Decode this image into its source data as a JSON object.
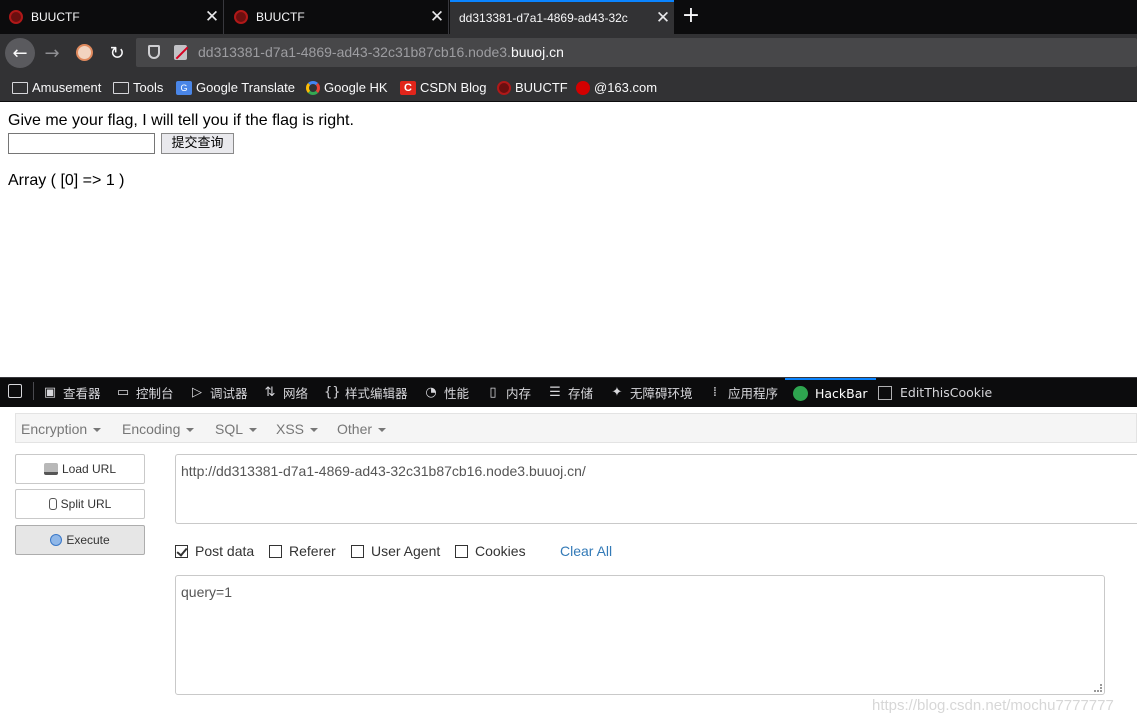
{
  "tabs": [
    {
      "title": "BUUCTF"
    },
    {
      "title": "BUUCTF"
    },
    {
      "title": "dd313381-d7a1-4869-ad43-32c"
    }
  ],
  "address_bar": {
    "url_prefix": "dd313381-d7a1-4869-ad43-32c31b87cb16.node3.",
    "url_host": "buuoj.cn"
  },
  "bookmarks": [
    {
      "label": "Amusement",
      "icon": "folder-icon"
    },
    {
      "label": "Tools",
      "icon": "folder-icon"
    },
    {
      "label": "Google Translate",
      "icon": "google-translate-icon"
    },
    {
      "label": "Google HK",
      "icon": "google-icon"
    },
    {
      "label": "CSDN Blog",
      "icon": "csdn-icon"
    },
    {
      "label": "BUUCTF",
      "icon": "buuctf-icon"
    },
    {
      "label": "@163.com",
      "icon": "netease-mail-icon"
    }
  ],
  "page": {
    "prompt": "Give me your flag, I will tell you if the flag is right.",
    "input_value": "",
    "submit_label": "提交查询",
    "result": "Array ( [0] => 1 )"
  },
  "devtools": {
    "tabs": [
      "查看器",
      "控制台",
      "调试器",
      "网络",
      "样式编辑器",
      "性能",
      "内存",
      "存储",
      "无障碍环境",
      "应用程序",
      "HackBar",
      "EditThisCookie"
    ],
    "active_tab": "HackBar"
  },
  "hackbar": {
    "menu": [
      "Encryption",
      "Encoding",
      "SQL",
      "XSS",
      "Other"
    ],
    "buttons": {
      "load": "Load URL",
      "split": "Split URL",
      "execute": "Execute"
    },
    "url": "http://dd313381-d7a1-4869-ad43-32c31b87cb16.node3.buuoj.cn/",
    "options": {
      "post_data": {
        "label": "Post data",
        "checked": true
      },
      "referer": {
        "label": "Referer",
        "checked": false
      },
      "user_agent": {
        "label": "User Agent",
        "checked": false
      },
      "cookies": {
        "label": "Cookies",
        "checked": false
      }
    },
    "clear_all": "Clear All",
    "post_body": "query=1"
  },
  "watermark": "https://blog.csdn.net/mochu7777777"
}
